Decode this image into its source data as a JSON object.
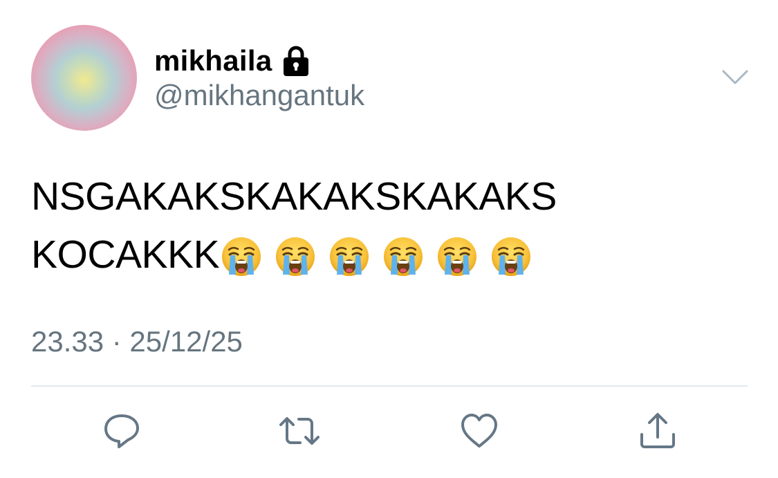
{
  "user": {
    "display_name": "mikhaila",
    "handle": "@mikhangantuk",
    "protected_icon": "lock-icon"
  },
  "tweet": {
    "text_line1": "NSGAKAKSKAKAKSKAKAKS",
    "text_line2": "KOCAKKK",
    "emoji": "loudly-crying-face",
    "emoji_count": 6,
    "timestamp": "23.33 · 25/12/25"
  },
  "actions": [
    {
      "name": "reply",
      "icon": "reply-icon"
    },
    {
      "name": "retweet",
      "icon": "retweet-icon"
    },
    {
      "name": "like",
      "icon": "heart-icon"
    },
    {
      "name": "share",
      "icon": "share-icon"
    }
  ],
  "colors": {
    "text": "#000000",
    "secondary": "#66757f",
    "divider": "#e1e8ed",
    "icon": "#657786"
  }
}
